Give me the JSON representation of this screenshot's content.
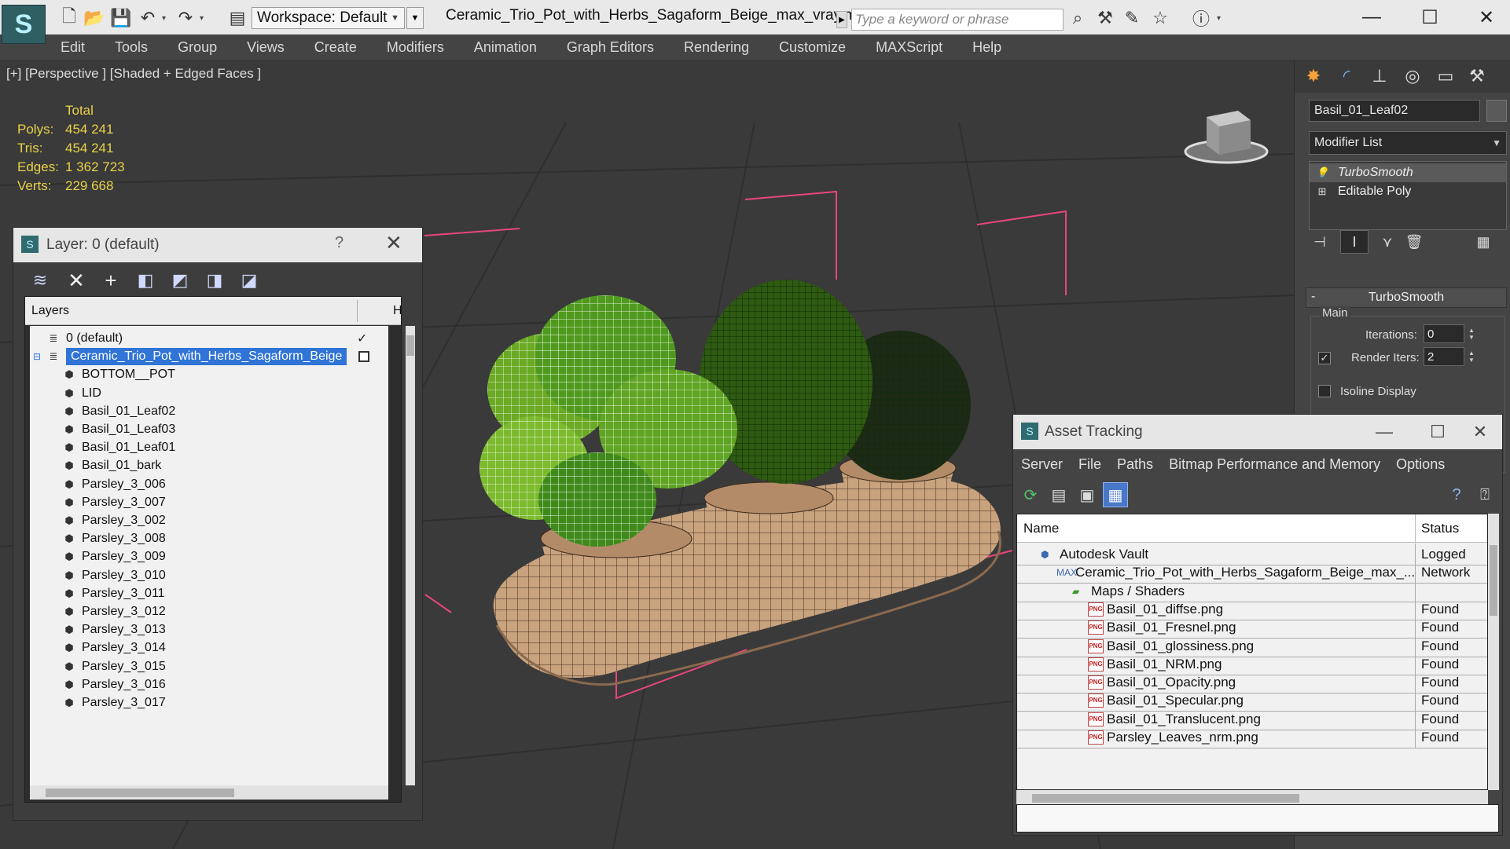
{
  "toolbar": {
    "workspace_label": "Workspace: Default",
    "document_title": "Ceramic_Trio_Pot_with_Herbs_Sagaform_Beige_max_vray.max",
    "search_placeholder": "Type a keyword or phrase"
  },
  "menu": [
    "Edit",
    "Tools",
    "Group",
    "Views",
    "Create",
    "Modifiers",
    "Animation",
    "Graph Editors",
    "Rendering",
    "Customize",
    "MAXScript",
    "Help"
  ],
  "viewport": {
    "label": "[+] [Perspective ] [Shaded + Edged Faces ]",
    "stats": {
      "header": "Total",
      "rows": [
        {
          "key": "Polys:",
          "value": "454 241"
        },
        {
          "key": "Tris:",
          "value": "454 241"
        },
        {
          "key": "Edges:",
          "value": "1 362 723"
        },
        {
          "key": "Verts:",
          "value": "229 668"
        }
      ]
    }
  },
  "layer_window": {
    "title": "Layer: 0 (default)",
    "help": "?",
    "column_layers": "Layers",
    "column_h": "H",
    "rows": [
      {
        "label": "0 (default)",
        "indent": 1,
        "check": "✓"
      },
      {
        "label": "Ceramic_Trio_Pot_with_Herbs_Sagaform_Beige",
        "indent": 1,
        "selected": true
      },
      {
        "label": "BOTTOM__POT",
        "indent": 2
      },
      {
        "label": "LID",
        "indent": 2
      },
      {
        "label": "Basil_01_Leaf02",
        "indent": 2
      },
      {
        "label": "Basil_01_Leaf03",
        "indent": 2
      },
      {
        "label": "Basil_01_Leaf01",
        "indent": 2
      },
      {
        "label": "Basil_01_bark",
        "indent": 2
      },
      {
        "label": "Parsley_3_006",
        "indent": 2
      },
      {
        "label": "Parsley_3_007",
        "indent": 2
      },
      {
        "label": "Parsley_3_002",
        "indent": 2
      },
      {
        "label": "Parsley_3_008",
        "indent": 2
      },
      {
        "label": "Parsley_3_009",
        "indent": 2
      },
      {
        "label": "Parsley_3_010",
        "indent": 2
      },
      {
        "label": "Parsley_3_011",
        "indent": 2
      },
      {
        "label": "Parsley_3_012",
        "indent": 2
      },
      {
        "label": "Parsley_3_013",
        "indent": 2
      },
      {
        "label": "Parsley_3_014",
        "indent": 2
      },
      {
        "label": "Parsley_3_015",
        "indent": 2
      },
      {
        "label": "Parsley_3_016",
        "indent": 2
      },
      {
        "label": "Parsley_3_017",
        "indent": 2
      }
    ]
  },
  "command_panel": {
    "object_name": "Basil_01_Leaf02",
    "modifier_list": "Modifier List",
    "stack": [
      "TurboSmooth",
      "Editable Poly"
    ],
    "rollout_title": "TurboSmooth",
    "group_main": "Main",
    "iterations_label": "Iterations:",
    "iterations_value": "0",
    "render_iters_label": "Render Iters:",
    "render_iters_value": "2",
    "isoline_label": "Isoline Display"
  },
  "asset_window": {
    "title": "Asset Tracking",
    "menus": [
      "Server",
      "File",
      "Paths",
      "Bitmap Performance and Memory",
      "Options"
    ],
    "col_name": "Name",
    "col_status": "Status",
    "rows": [
      {
        "name": "Autodesk Vault",
        "status": "Logged",
        "indent": 1,
        "icon": "vault"
      },
      {
        "name": "Ceramic_Trio_Pot_with_Herbs_Sagaform_Beige_max_...",
        "status": "Network",
        "indent": 2,
        "icon": "max"
      },
      {
        "name": "Maps / Shaders",
        "status": "",
        "indent": 3,
        "icon": "maps"
      },
      {
        "name": "Basil_01_diffse.png",
        "status": "Found",
        "indent": 4,
        "icon": "png"
      },
      {
        "name": "Basil_01_Fresnel.png",
        "status": "Found",
        "indent": 4,
        "icon": "png"
      },
      {
        "name": "Basil_01_glossiness.png",
        "status": "Found",
        "indent": 4,
        "icon": "png"
      },
      {
        "name": "Basil_01_NRM.png",
        "status": "Found",
        "indent": 4,
        "icon": "png"
      },
      {
        "name": "Basil_01_Opacity.png",
        "status": "Found",
        "indent": 4,
        "icon": "png"
      },
      {
        "name": "Basil_01_Specular.png",
        "status": "Found",
        "indent": 4,
        "icon": "png"
      },
      {
        "name": "Basil_01_Translucent.png",
        "status": "Found",
        "indent": 4,
        "icon": "png"
      },
      {
        "name": "Parsley_Leaves_nrm.png",
        "status": "Found",
        "indent": 4,
        "icon": "png"
      }
    ]
  },
  "colors": {
    "stats_yellow": "#e8d24a",
    "selection_blue": "#2f74d6",
    "viewport_bg": "#3a3a3a",
    "pot_beige": "#c9a27e",
    "leaf_green": "#4f9a1e"
  }
}
